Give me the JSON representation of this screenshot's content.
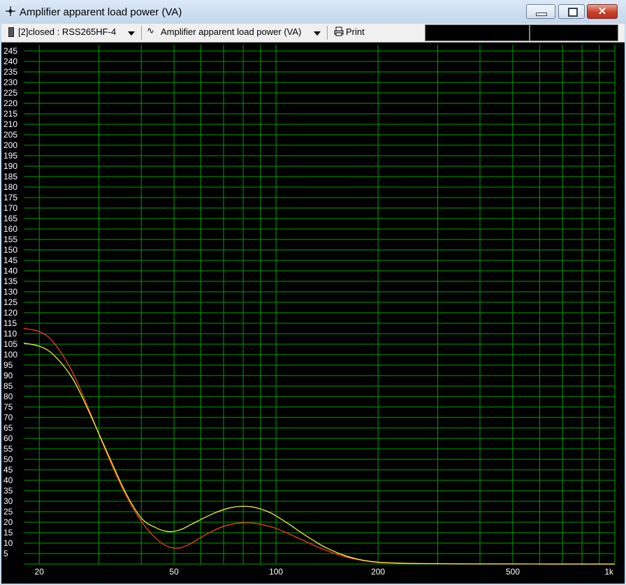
{
  "window": {
    "title": "Amplifier apparent load power (VA)",
    "close_glyph": "✕"
  },
  "toolbar": {
    "source_label": "[2]closed : RSS265HF-4",
    "measurement_label": "Amplifier apparent load power (VA)",
    "wave_icon": "∿",
    "print_label": "Print"
  },
  "icons": {
    "title": "crosshair-icon",
    "source": "speaker-icon",
    "measurement": "sine-wave-icon",
    "print": "printer-icon",
    "dropdown": "chevron-down-icon"
  },
  "colors": {
    "background": "#000000",
    "grid": "#00a000",
    "series_1": "#ffff40",
    "series_2": "#ff4a1a",
    "text": "#ffffff"
  },
  "chart_data": {
    "type": "line",
    "title": "",
    "xlabel": "",
    "ylabel": "",
    "xscale": "log",
    "xlim": [
      18,
      1000
    ],
    "ylim": [
      0,
      248
    ],
    "x_tick_labels": [
      {
        "value": 20,
        "label": "20"
      },
      {
        "value": 50,
        "label": "50"
      },
      {
        "value": 100,
        "label": "100"
      },
      {
        "value": 200,
        "label": "200"
      },
      {
        "value": 500,
        "label": "500"
      },
      {
        "value": 1000,
        "label": "1k"
      }
    ],
    "x_grid": [
      20,
      30,
      40,
      50,
      60,
      70,
      80,
      90,
      100,
      200,
      300,
      400,
      500,
      600,
      700,
      800,
      900,
      1000
    ],
    "y_ticks": [
      5,
      10,
      15,
      20,
      25,
      30,
      35,
      40,
      45,
      50,
      55,
      60,
      65,
      70,
      75,
      80,
      85,
      90,
      95,
      100,
      105,
      110,
      115,
      120,
      125,
      130,
      135,
      140,
      145,
      150,
      155,
      160,
      165,
      170,
      175,
      180,
      185,
      190,
      195,
      200,
      205,
      210,
      215,
      220,
      225,
      230,
      235,
      240,
      245
    ],
    "grid": true,
    "series": [
      {
        "color": "#ffff40",
        "x": [
          18,
          20,
          22,
          25,
          28,
          32,
          36,
          40,
          44,
          48,
          52,
          56,
          60,
          65,
          70,
          75,
          80,
          85,
          90,
          95,
          100,
          110,
          120,
          130,
          140,
          160,
          180,
          200,
          250,
          300,
          400,
          500,
          700,
          1000
        ],
        "y": [
          105.5,
          104,
          100,
          89,
          73,
          52,
          34,
          22,
          17.5,
          15.5,
          16.3,
          18.8,
          21.3,
          24,
          26,
          27.2,
          27.6,
          27.3,
          26.3,
          24.9,
          23,
          18.7,
          14.5,
          10.9,
          7.9,
          4,
          1.9,
          0.9,
          0.3,
          0.15,
          0.05,
          0.02,
          0.01,
          0
        ]
      },
      {
        "color": "#ff4a1a",
        "x": [
          18,
          20,
          22,
          25,
          28,
          32,
          36,
          40,
          44,
          48,
          52,
          56,
          60,
          65,
          70,
          75,
          80,
          85,
          90,
          95,
          100,
          110,
          120,
          130,
          140,
          160,
          180,
          200,
          250,
          300,
          400,
          500,
          700,
          1000
        ],
        "y": [
          112.5,
          111,
          106,
          92,
          74,
          51,
          33,
          20.5,
          12.5,
          8.3,
          7.7,
          9.8,
          12.7,
          15.8,
          18,
          19.2,
          19.7,
          19.6,
          19,
          18.1,
          17,
          14.2,
          11.4,
          8.8,
          6.6,
          3.5,
          1.7,
          0.8,
          0.3,
          0.15,
          0.05,
          0.02,
          0.01,
          0
        ]
      }
    ]
  }
}
